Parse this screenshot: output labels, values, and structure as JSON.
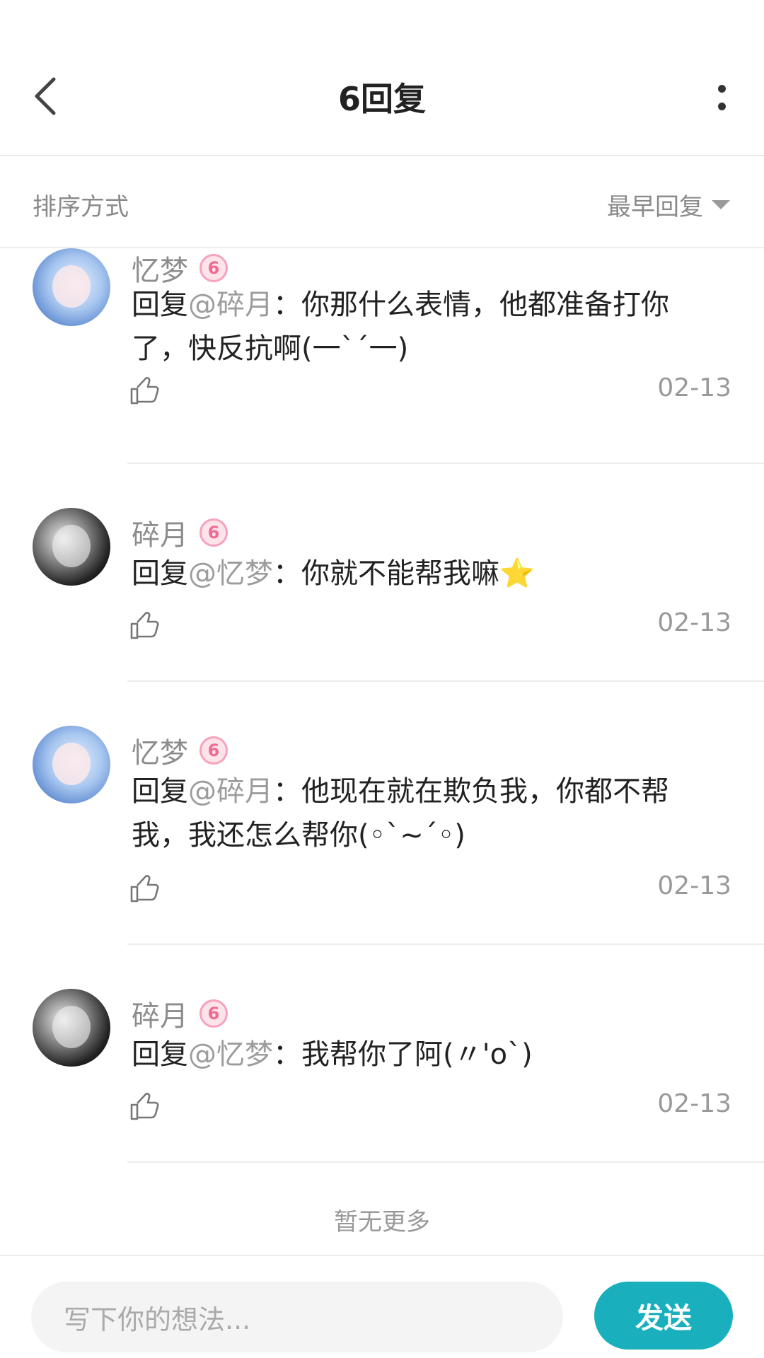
{
  "header": {
    "title": "6回复"
  },
  "sort": {
    "label": "排序方式",
    "selected": "最早回复"
  },
  "comments": [
    {
      "author": "忆梦",
      "level": "6",
      "prefix": "回复",
      "mention": "@碎月",
      "content": "：你那什么表情，他都准备打你了，快反抗啊(一`´一)",
      "date": "02-13",
      "avatar": "light"
    },
    {
      "author": "碎月",
      "level": "6",
      "prefix": "回复",
      "mention": "@忆梦",
      "content": "：你就不能帮我嘛⭐",
      "date": "02-13",
      "avatar": "dark"
    },
    {
      "author": "忆梦",
      "level": "6",
      "prefix": "回复",
      "mention": "@碎月",
      "content": "：他现在就在欺负我，你都不帮我，我还怎么帮你(◦`~´◦)",
      "date": "02-13",
      "avatar": "light"
    },
    {
      "author": "碎月",
      "level": "6",
      "prefix": "回复",
      "mention": "@忆梦",
      "content": "：我帮你了阿(〃'o`)",
      "date": "02-13",
      "avatar": "dark"
    }
  ],
  "footer_note": "暂无更多",
  "composer": {
    "placeholder": "写下你的想法...",
    "send_label": "发送"
  }
}
